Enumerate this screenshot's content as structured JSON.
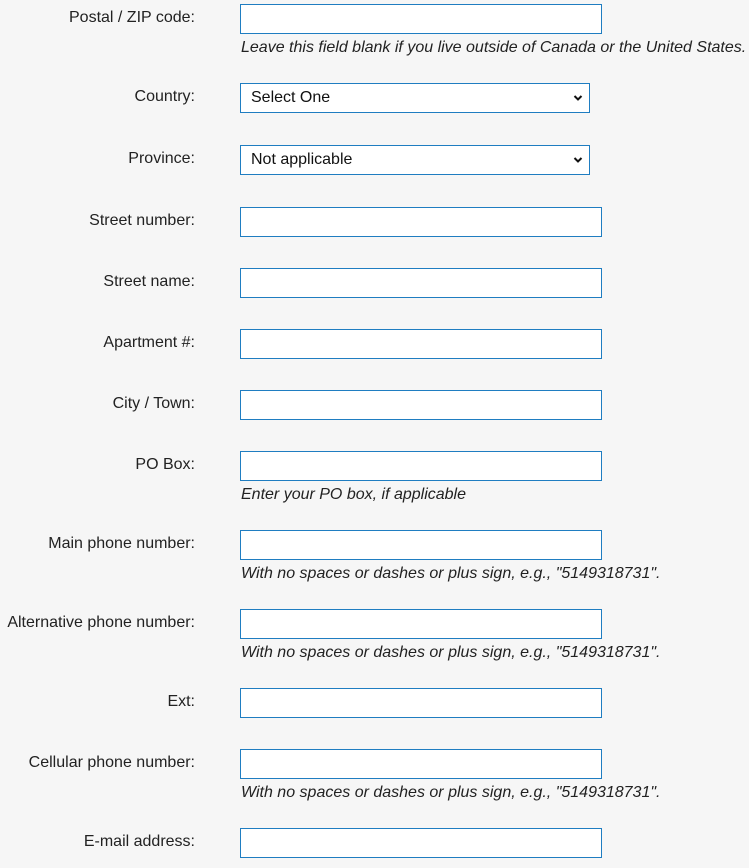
{
  "form": {
    "postal": {
      "label": "Postal / ZIP code:",
      "value": "",
      "hint": "Leave this field blank if you live outside of Canada or the United States."
    },
    "country": {
      "label": "Country:",
      "selected": "Select One"
    },
    "province": {
      "label": "Province:",
      "selected": "Not applicable"
    },
    "street_number": {
      "label": "Street number:",
      "value": ""
    },
    "street_name": {
      "label": "Street name:",
      "value": ""
    },
    "apartment": {
      "label": "Apartment #:",
      "value": ""
    },
    "city": {
      "label": "City / Town:",
      "value": ""
    },
    "po_box": {
      "label": "PO Box:",
      "value": "",
      "hint": "Enter your PO box, if applicable"
    },
    "main_phone": {
      "label": "Main phone number:",
      "value": "",
      "hint": "With no spaces or dashes or plus sign, e.g., \"5149318731\"."
    },
    "alt_phone": {
      "label": "Alternative phone number:",
      "value": "",
      "hint": "With no spaces or dashes or plus sign, e.g., \"5149318731\"."
    },
    "ext": {
      "label": "Ext:",
      "value": ""
    },
    "cell_phone": {
      "label": "Cellular phone number:",
      "value": "",
      "hint": "With no spaces or dashes or plus sign, e.g., \"5149318731\"."
    },
    "email": {
      "label": "E-mail address:",
      "value": ""
    }
  },
  "colors": {
    "field_border": "#1f7dc1",
    "background": "#f6f6f6"
  }
}
